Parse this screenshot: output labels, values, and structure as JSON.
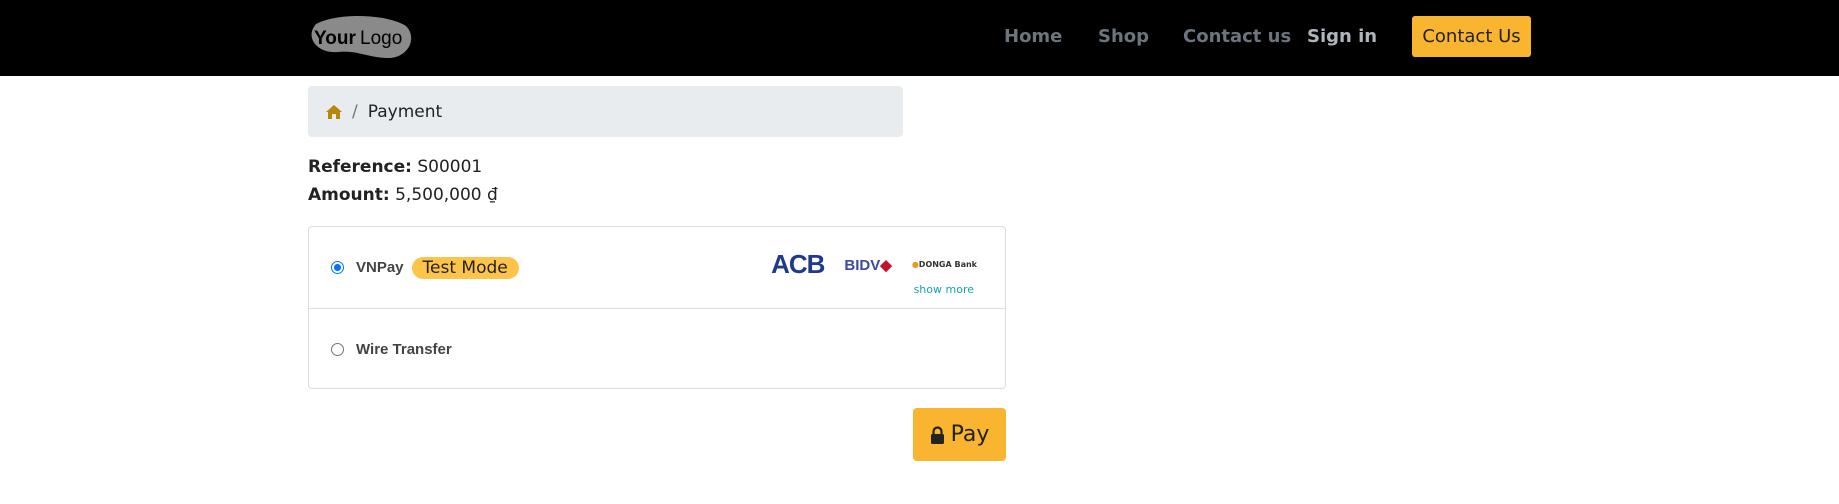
{
  "header": {
    "logo_text": "YourLogo",
    "nav": [
      {
        "label": "Home"
      },
      {
        "label": "Shop"
      },
      {
        "label": "Contact us"
      },
      {
        "label": "Sign in"
      }
    ],
    "cta_label": "Contact Us"
  },
  "breadcrumb": {
    "home_icon": "home-icon",
    "current": "Payment"
  },
  "order": {
    "reference_label": "Reference:",
    "reference": "S00001",
    "amount_label": "Amount:",
    "amount": "5,500,000 ₫"
  },
  "payment_methods": [
    {
      "label": "VNPay",
      "selected": true,
      "badge": "Test Mode",
      "banks": [
        "ACB",
        "BIDV",
        "DONGA Bank"
      ],
      "show_more": "show more"
    },
    {
      "label": "Wire Transfer",
      "selected": false
    }
  ],
  "pay_button": {
    "label": "Pay",
    "icon": "lock-icon"
  },
  "colors": {
    "accent": "#f9b52f",
    "badge": "#fcc54a",
    "link": "#17a2b8"
  }
}
